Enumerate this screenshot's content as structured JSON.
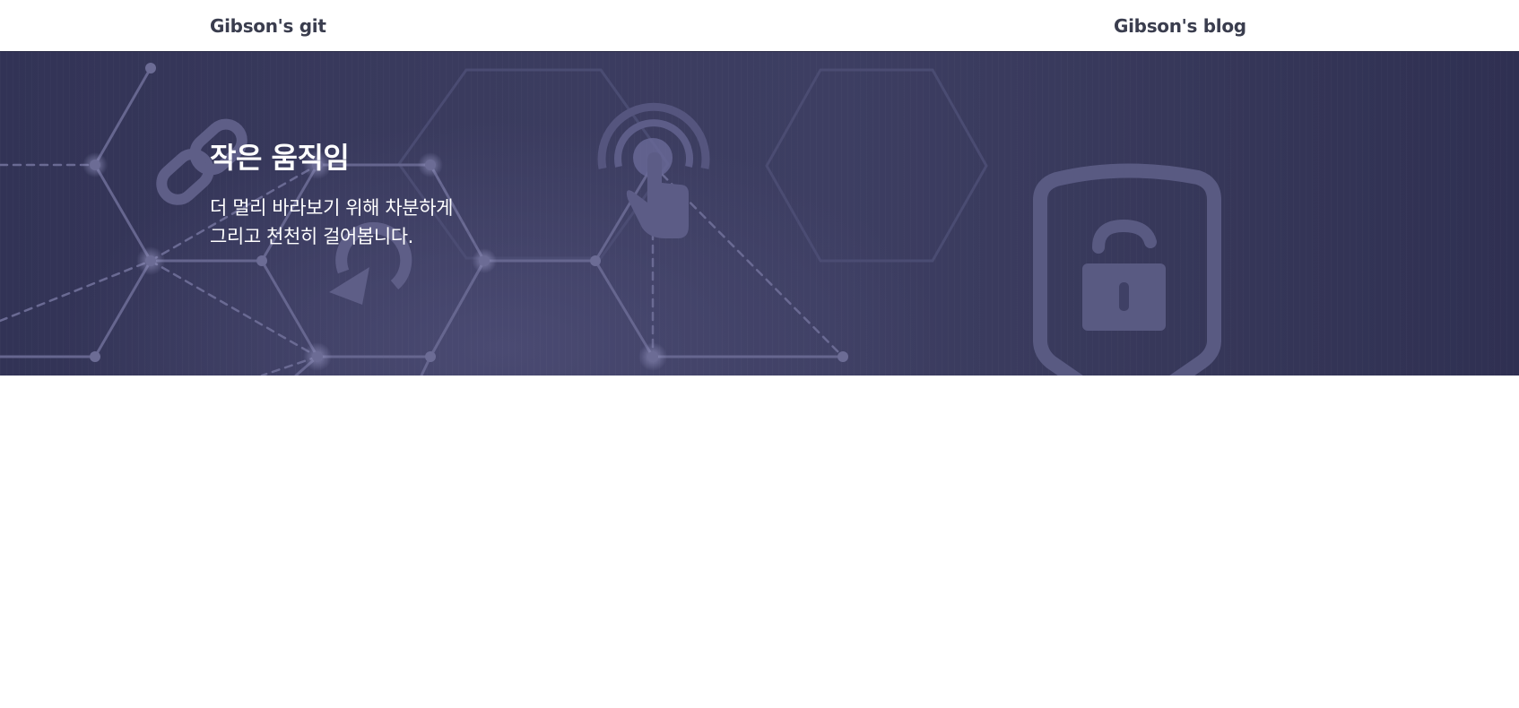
{
  "header": {
    "left_link": "Gibson's git",
    "right_link": "Gibson's blog"
  },
  "hero": {
    "title": "작은 움직임",
    "subtitle_line1": "더 멀리 바라보기 위해 차분하게",
    "subtitle_line2": "그리고 천천히 걸어봅니다.",
    "icons": [
      "chain-link-icon",
      "refresh-icon",
      "touch-icon",
      "shield-lock-icon"
    ]
  },
  "colors": {
    "hero_background": "#35365a",
    "header_text": "#3a3d4e",
    "hero_text": "#ffffff",
    "decoration": "#5e5e86"
  }
}
